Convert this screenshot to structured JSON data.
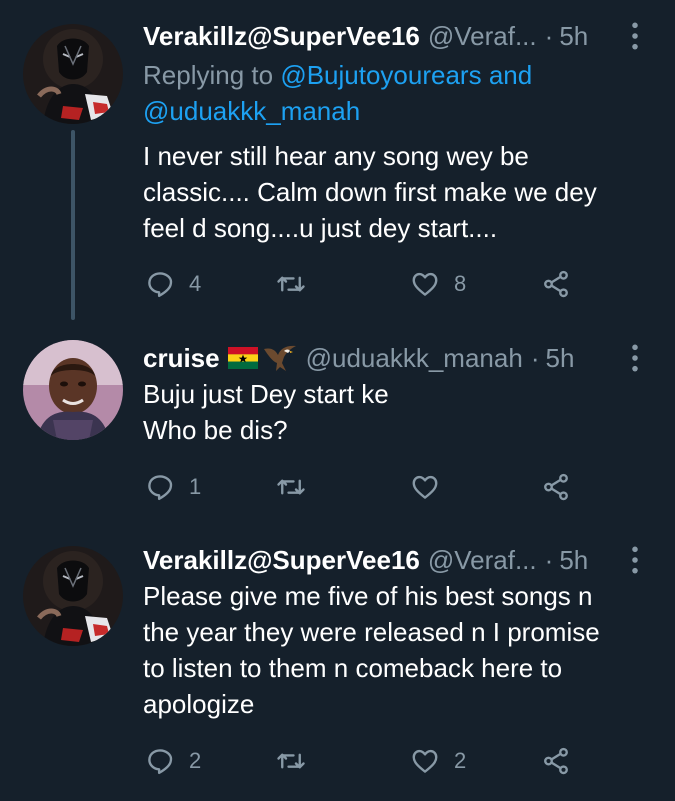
{
  "colors": {
    "background": "#15202b",
    "secondary_text": "#8899a6",
    "link": "#1da1f2",
    "thread_line": "#3d5466"
  },
  "tweets": [
    {
      "name": "Verakillz@SuperVee16",
      "handle": "@Veraf...",
      "dot": "·",
      "time": "5h",
      "replying_prefix": "Replying to",
      "replying_mention_1": "@Bujutoyourears",
      "replying_and": "and",
      "replying_mention_2": "@uduakkk_manah",
      "lines": [
        "I never still hear any song wey be",
        "classic.... Calm down first make we dey",
        "feel d song....u just dey start...."
      ],
      "reply_count": "4",
      "retweet_count": "",
      "like_count": "8"
    },
    {
      "name": "cruise",
      "handle": "@uduakkk_manah",
      "dot": "·",
      "time": "5h",
      "lines": [
        "Buju just Dey start ke",
        "Who be dis?"
      ],
      "reply_count": "1",
      "retweet_count": "",
      "like_count": ""
    },
    {
      "name": "Verakillz@SuperVee16",
      "handle": "@Veraf...",
      "dot": "·",
      "time": "5h",
      "lines": [
        "Please give me five of his best songs n",
        "the year  they were released n I promise",
        "to listen to them n comeback here to",
        "apologize"
      ],
      "reply_count": "2",
      "retweet_count": "",
      "like_count": "2"
    }
  ],
  "icons": {
    "reply": "reply-icon",
    "retweet": "retweet-icon",
    "like": "heart-icon",
    "share": "share-icon",
    "more": "more-vertical-icon",
    "flag": "ghana-flag-icon",
    "eagle": "eagle-icon"
  }
}
